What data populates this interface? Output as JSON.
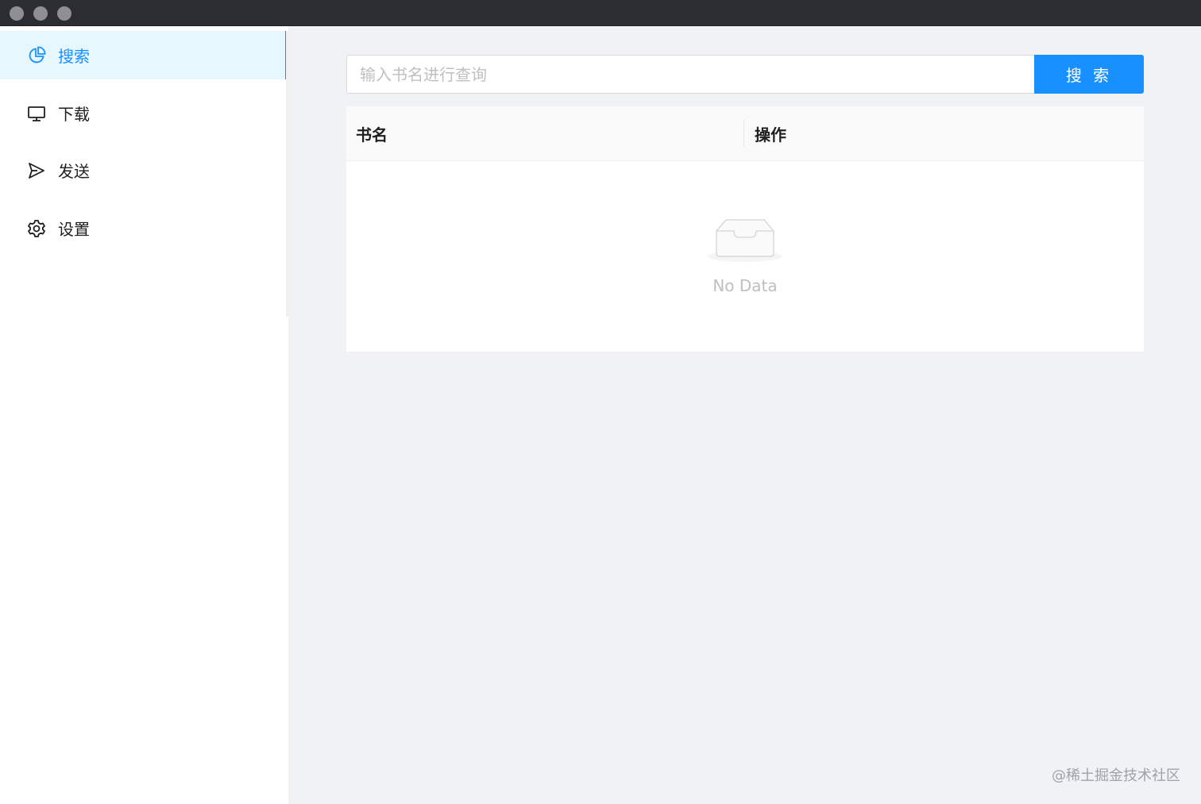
{
  "window": {
    "controls": [
      "close",
      "minimize",
      "zoom"
    ]
  },
  "sidebar": {
    "items": [
      {
        "label": "搜索",
        "icon": "pie-chart-icon",
        "active": true
      },
      {
        "label": "下载",
        "icon": "desktop-icon",
        "active": false
      },
      {
        "label": "发送",
        "icon": "send-icon",
        "active": false
      },
      {
        "label": "设置",
        "icon": "gear-icon",
        "active": false
      }
    ]
  },
  "search": {
    "placeholder": "输入书名进行查询",
    "value": "",
    "button_label": "搜 索"
  },
  "table": {
    "columns": [
      "书名",
      "操作"
    ],
    "rows": [],
    "empty_text": "No Data"
  },
  "watermark": "@稀土掘金技术社区",
  "colors": {
    "accent": "#1890ff",
    "active_bg": "#e6f7ff",
    "content_bg": "#f0f2f5",
    "titlebar": "#2b2d33"
  }
}
